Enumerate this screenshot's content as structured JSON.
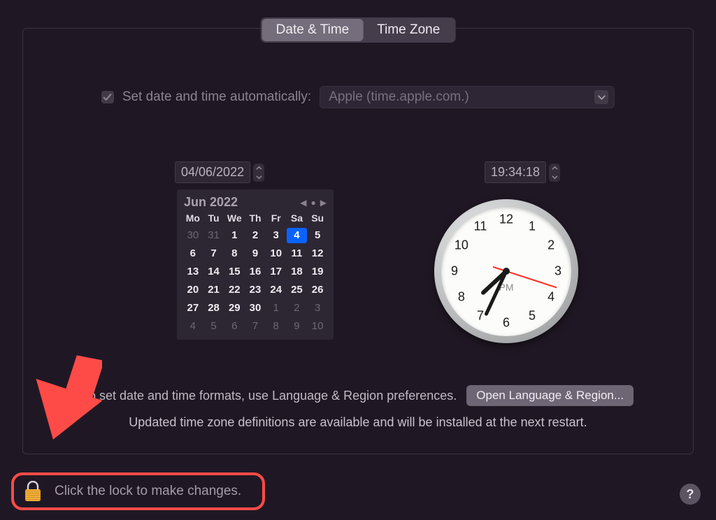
{
  "tabs": {
    "date_time": "Date & Time",
    "time_zone": "Time Zone"
  },
  "auto": {
    "label": "Set date and time automatically:",
    "checked": true,
    "server": "Apple (time.apple.com.)"
  },
  "date_field": "04/06/2022",
  "time_field": "19:34:18",
  "calendar": {
    "title": "Jun 2022",
    "dow": [
      "Mo",
      "Tu",
      "We",
      "Th",
      "Fr",
      "Sa",
      "Su"
    ],
    "grid": [
      {
        "n": "30",
        "o": true
      },
      {
        "n": "31",
        "o": true
      },
      {
        "n": "1"
      },
      {
        "n": "2"
      },
      {
        "n": "3"
      },
      {
        "n": "4",
        "sel": true
      },
      {
        "n": "5"
      },
      {
        "n": "6"
      },
      {
        "n": "7"
      },
      {
        "n": "8"
      },
      {
        "n": "9"
      },
      {
        "n": "10"
      },
      {
        "n": "11"
      },
      {
        "n": "12"
      },
      {
        "n": "13"
      },
      {
        "n": "14"
      },
      {
        "n": "15"
      },
      {
        "n": "16"
      },
      {
        "n": "17"
      },
      {
        "n": "18"
      },
      {
        "n": "19"
      },
      {
        "n": "20"
      },
      {
        "n": "21"
      },
      {
        "n": "22"
      },
      {
        "n": "23"
      },
      {
        "n": "24"
      },
      {
        "n": "25"
      },
      {
        "n": "26"
      },
      {
        "n": "27"
      },
      {
        "n": "28"
      },
      {
        "n": "29"
      },
      {
        "n": "30"
      },
      {
        "n": "1",
        "o": true
      },
      {
        "n": "2",
        "o": true
      },
      {
        "n": "3",
        "o": true
      },
      {
        "n": "4",
        "o": true
      },
      {
        "n": "5",
        "o": true
      },
      {
        "n": "6",
        "o": true
      },
      {
        "n": "7",
        "o": true
      },
      {
        "n": "8",
        "o": true
      },
      {
        "n": "9",
        "o": true
      },
      {
        "n": "10",
        "o": true
      }
    ]
  },
  "clock": {
    "ampm": "PM",
    "hour_deg": 227,
    "minute_deg": 205,
    "second_deg": 108
  },
  "footer": {
    "formats_text": "To set date and time formats, use Language & Region preferences.",
    "open_button": "Open Language & Region...",
    "tz_update": "Updated time zone definitions are available and will be installed at the next restart."
  },
  "lock_text": "Click the lock to make changes.",
  "help": "?"
}
